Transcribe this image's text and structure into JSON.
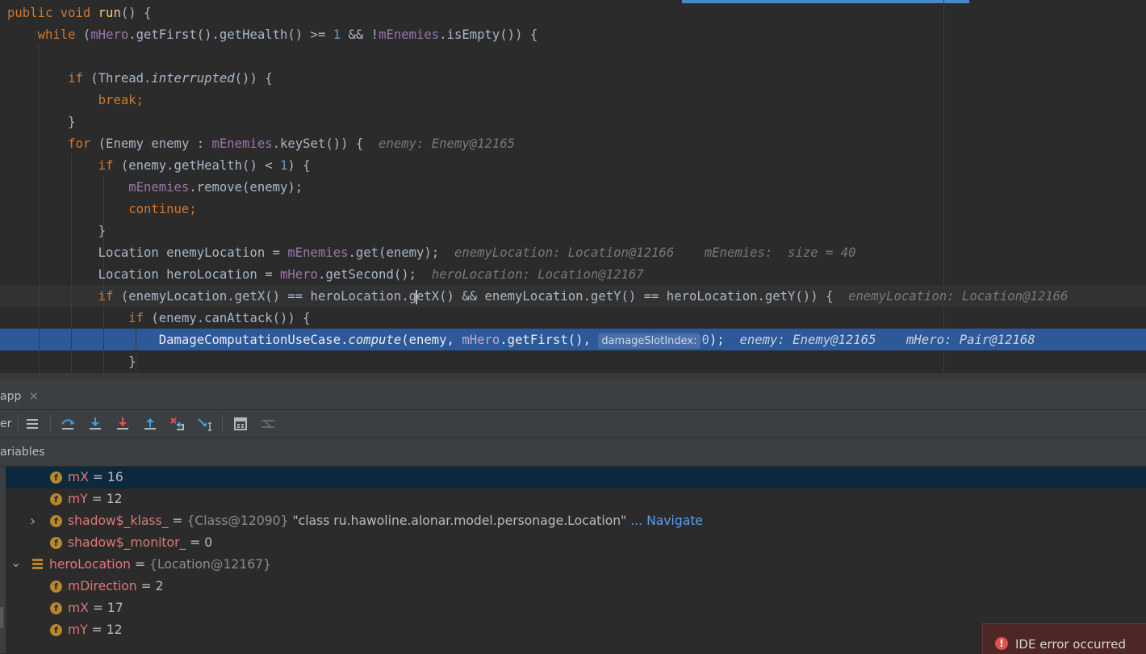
{
  "editor": {
    "lines": {
      "l1": {
        "t1": "public void ",
        "t2": "run",
        "t3": "() {"
      },
      "l2": {
        "k": "while ",
        "t1": "(",
        "f1": "mHero",
        "t2": ".getFirst().getHealth() >= ",
        "n": "1",
        "t3": " && !",
        "f2": "mEnemies",
        "t4": ".isEmpty()) {"
      },
      "l4": {
        "k": "if ",
        "t1": "(Thread.",
        "i": "interrupted",
        "t2": "()) {"
      },
      "l5": {
        "k": "break;"
      },
      "l6": {
        "t": "}"
      },
      "l7": {
        "k": "for ",
        "t1": "(Enemy enemy : ",
        "f": "mEnemies",
        "t2": ".keySet()) {",
        "h": "enemy: Enemy@12165"
      },
      "l8": {
        "k": "if ",
        "t1": "(enemy.getHealth() < ",
        "n": "1",
        "t2": ") {"
      },
      "l9": {
        "f": "mEnemies",
        "t": ".remove(enemy);"
      },
      "l10": {
        "k": "continue;"
      },
      "l11": {
        "t": "}"
      },
      "l12": {
        "t1": "Location enemyLocation = ",
        "f": "mEnemies",
        "t2": ".get(enemy);",
        "h1": "enemyLocation: Location@12166",
        "h2": "mEnemies:  size = 40"
      },
      "l13": {
        "t1": "Location heroLocation = ",
        "f": "mHero",
        "t2": ".getSecond();",
        "h": "heroLocation: Location@12167"
      },
      "l14": {
        "k": "if ",
        "t1": "(enemyLocation.getX() == heroLocation.g",
        "t2": "etX() && enemyLocation.getY() == heroLocation.getY()) {",
        "h": "enemyLocation: Location@12166"
      },
      "l15": {
        "k": "if ",
        "t": "(enemy.canAttack()) {"
      },
      "l16": {
        "t1": "DamageComputationUseCase.",
        "i": "compute",
        "t2": "(enemy, ",
        "f": "mHero",
        "t3": ".getFirst(), ",
        "p": "damageSlotIndex:",
        "n": "0",
        "t4": ");",
        "h1": "enemy: Enemy@12165",
        "h2": "mHero: Pair@12168"
      },
      "l17": {
        "t": "}"
      }
    }
  },
  "debug_panel": {
    "tab_label": "app",
    "close_glyph": "×",
    "toolbar_label": "er",
    "toolbar": [
      {
        "name": "show-execution-point",
        "color": "#aeb9c0"
      },
      {
        "name": "step-over",
        "color": "#3d9ee0"
      },
      {
        "name": "step-into",
        "color": "#3d9ee0"
      },
      {
        "name": "force-step-into",
        "color": "#e5504b"
      },
      {
        "name": "step-out",
        "color": "#3d9ee0"
      },
      {
        "name": "drop-frame",
        "color": "#e5504b"
      },
      {
        "name": "run-to-cursor",
        "color": "#3d9ee0"
      },
      {
        "name": "evaluate-expression",
        "color": "#aeb9c0"
      },
      {
        "name": "trace-current-stream",
        "color": "#666666"
      }
    ],
    "variables_title": "ariables",
    "variables": {
      "r1": {
        "name": "mX",
        "eq": " = ",
        "value": "16"
      },
      "r2": {
        "name": "mY",
        "eq": " = ",
        "value": "12"
      },
      "r3": {
        "name": "shadow$_klass_",
        "eq": " = ",
        "ref": "{Class@12090}",
        "value": " \"class ru.hawoline.alonar.model.personage.Location\"",
        "link": " ... Navigate"
      },
      "r4": {
        "name": "shadow$_monitor_",
        "eq": " = ",
        "value": "0"
      },
      "r5": {
        "name": "heroLocation",
        "eq": " = ",
        "ref": "{Location@12167}"
      },
      "r6": {
        "name": "mDirection",
        "eq": " = ",
        "value": "2"
      },
      "r7": {
        "name": "mX",
        "eq": " = ",
        "value": "17"
      },
      "r8": {
        "name": "mY",
        "eq": " = ",
        "value": "12"
      }
    },
    "field_icon_letter": "f",
    "arrow_right": "›",
    "arrow_down": "⌄"
  },
  "notification": {
    "icon": "!",
    "text": "IDE error occurred"
  }
}
